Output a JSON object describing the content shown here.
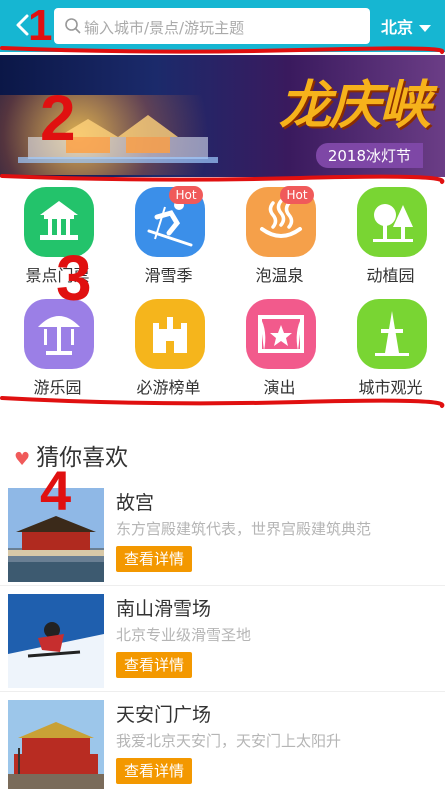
{
  "header": {
    "search_placeholder": "输入城市/景点/游玩主题",
    "city": "北京"
  },
  "banner": {
    "title": "龙庆峡",
    "subtitle": "2018冰灯节"
  },
  "categories": [
    {
      "label": "景点门票",
      "icon": "pavilion-icon",
      "color": "#23c36b",
      "hot": false
    },
    {
      "label": "滑雪季",
      "icon": "skier-icon",
      "color": "#3b8fe9",
      "hot": true
    },
    {
      "label": "泡温泉",
      "icon": "hot-spring-icon",
      "color": "#f5a04a",
      "hot": true
    },
    {
      "label": "动植园",
      "icon": "trees-icon",
      "color": "#79d533",
      "hot": false
    },
    {
      "label": "游乐园",
      "icon": "carousel-icon",
      "color": "#9b7fe6",
      "hot": false
    },
    {
      "label": "必游榜单",
      "icon": "castle-icon",
      "color": "#f5b51c",
      "hot": false
    },
    {
      "label": "演出",
      "icon": "stage-icon",
      "color": "#f25a8c",
      "hot": false
    },
    {
      "label": "城市观光",
      "icon": "tower-icon",
      "color": "#79d533",
      "hot": false
    }
  ],
  "hot_badge": "Hot",
  "recommend": {
    "title": "猜你喜欢",
    "button_label": "查看详情",
    "items": [
      {
        "name": "故宫",
        "desc": "东方宫殿建筑代表，世界宫殿建筑典范"
      },
      {
        "name": "南山滑雪场",
        "desc": "北京专业级滑雪圣地"
      },
      {
        "name": "天安门广场",
        "desc": "我爱北京天安门，天安门上太阳升"
      }
    ]
  },
  "annotations": [
    "1",
    "2",
    "3",
    "4"
  ]
}
